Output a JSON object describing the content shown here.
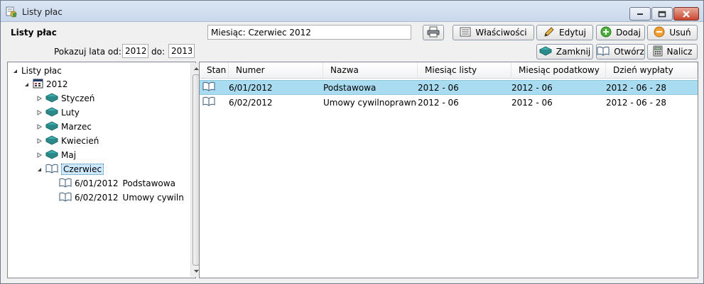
{
  "window": {
    "title": "Listy płac",
    "app_icon": "payroll-app-icon"
  },
  "toolbar": {
    "header_label": "Listy płac",
    "years_label": "Pokazuj lata od:",
    "year_from": "2012",
    "to_label": "do:",
    "year_to": "2013",
    "month_display": "Miesiąc: Czerwiec 2012",
    "print_icon": "printer-icon",
    "properties_label": "Właściwości",
    "edit_label": "Edytuj",
    "add_label": "Dodaj",
    "delete_label": "Usuń",
    "close_label": "Zamknij",
    "open_label": "Otwórz",
    "calculate_label": "Nalicz"
  },
  "tree": {
    "root": "Listy płac",
    "year": "2012",
    "months": [
      "Styczeń",
      "Luty",
      "Marzec",
      "Kwiecień",
      "Maj",
      "Czerwiec"
    ],
    "selected_month": "Czerwiec",
    "lists": [
      {
        "number": "6/01/2012",
        "name": "Podstawowa"
      },
      {
        "number": "6/02/2012",
        "name": "Umowy cywilnopr"
      }
    ]
  },
  "grid": {
    "columns": [
      "Stan",
      "Numer",
      "Nazwa",
      "Miesiąc listy",
      "Miesiąc podatkowy",
      "Dzień wypłaty"
    ],
    "rows": [
      {
        "numer": "6/01/2012",
        "nazwa": "Podstawowa",
        "miesiac_listy": "2012 - 06",
        "miesiac_podatkowy": "2012 - 06",
        "dzien_wyplaty": "2012 - 06 - 28"
      },
      {
        "numer": "6/02/2012",
        "nazwa": "Umowy cywilnoprawne",
        "miesiac_listy": "2012 - 06",
        "miesiac_podatkowy": "2012 - 06",
        "dzien_wyplaty": "2012 - 06 - 28"
      }
    ],
    "selected_row": 0
  },
  "colors": {
    "selection": "#a9dcf0",
    "close_button": "#c8462f",
    "book_teal": "#2a9a9a"
  }
}
